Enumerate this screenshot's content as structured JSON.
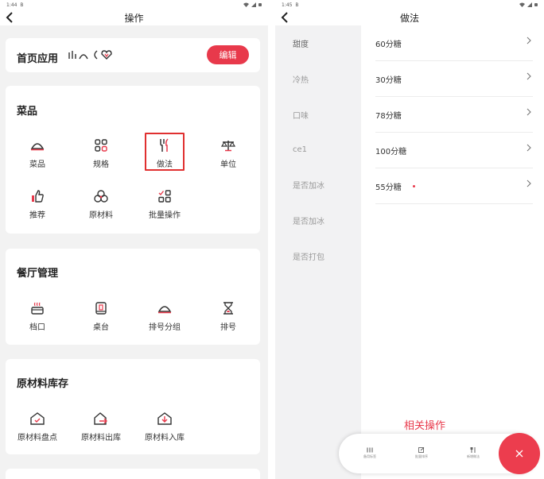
{
  "left": {
    "status_time": "1:44",
    "status_notif": "B",
    "title": "操作",
    "home_card": {
      "title": "首页应用",
      "edit_label": "编辑"
    },
    "dishes": {
      "title": "菜品",
      "items": [
        {
          "label": "菜品",
          "icon": "cloche-icon"
        },
        {
          "label": "规格",
          "icon": "grid-icon"
        },
        {
          "label": "做法",
          "icon": "cutlery-icon"
        },
        {
          "label": "单位",
          "icon": "scale-icon"
        },
        {
          "label": "推荐",
          "icon": "thumbs-up-icon"
        },
        {
          "label": "原材料",
          "icon": "ingredients-icon"
        },
        {
          "label": "批量操作",
          "icon": "batch-grid-icon"
        }
      ]
    },
    "restaurant": {
      "title": "餐厅管理",
      "items": [
        {
          "label": "档口",
          "icon": "stall-icon"
        },
        {
          "label": "桌台",
          "icon": "table-icon"
        },
        {
          "label": "排号分组",
          "icon": "queue-group-icon"
        },
        {
          "label": "排号",
          "icon": "hourglass-icon"
        }
      ]
    },
    "inventory": {
      "title": "原材料库存",
      "items": [
        {
          "label": "原材料盘点",
          "icon": "stocktake-icon"
        },
        {
          "label": "原材料出库",
          "icon": "outbound-icon"
        },
        {
          "label": "原材料入库",
          "icon": "inbound-icon"
        }
      ]
    }
  },
  "right": {
    "status_time": "1:45",
    "status_notif": "B",
    "title": "做法",
    "categories": [
      {
        "label": "甜度",
        "active": true
      },
      {
        "label": "冷热",
        "active": false
      },
      {
        "label": "口味",
        "active": false
      },
      {
        "label": "ce1",
        "active": false
      },
      {
        "label": "是否加冰",
        "active": false
      },
      {
        "label": "是否加冰",
        "active": false
      },
      {
        "label": "是否打包",
        "active": false
      }
    ],
    "options": [
      {
        "label": "60分糖",
        "dot": false
      },
      {
        "label": "30分糖",
        "dot": false
      },
      {
        "label": "78分糖",
        "dot": false
      },
      {
        "label": "100分糖",
        "dot": false
      },
      {
        "label": "55分糖",
        "dot": true
      }
    ],
    "ops_label": "相关操作",
    "ops": [
      {
        "label": "备用标签",
        "icon": "list-icon"
      },
      {
        "label": "批量排序",
        "icon": "edit-icon"
      },
      {
        "label": "新增做法",
        "icon": "cutlery-icon"
      }
    ],
    "accent": "#e8394b"
  }
}
